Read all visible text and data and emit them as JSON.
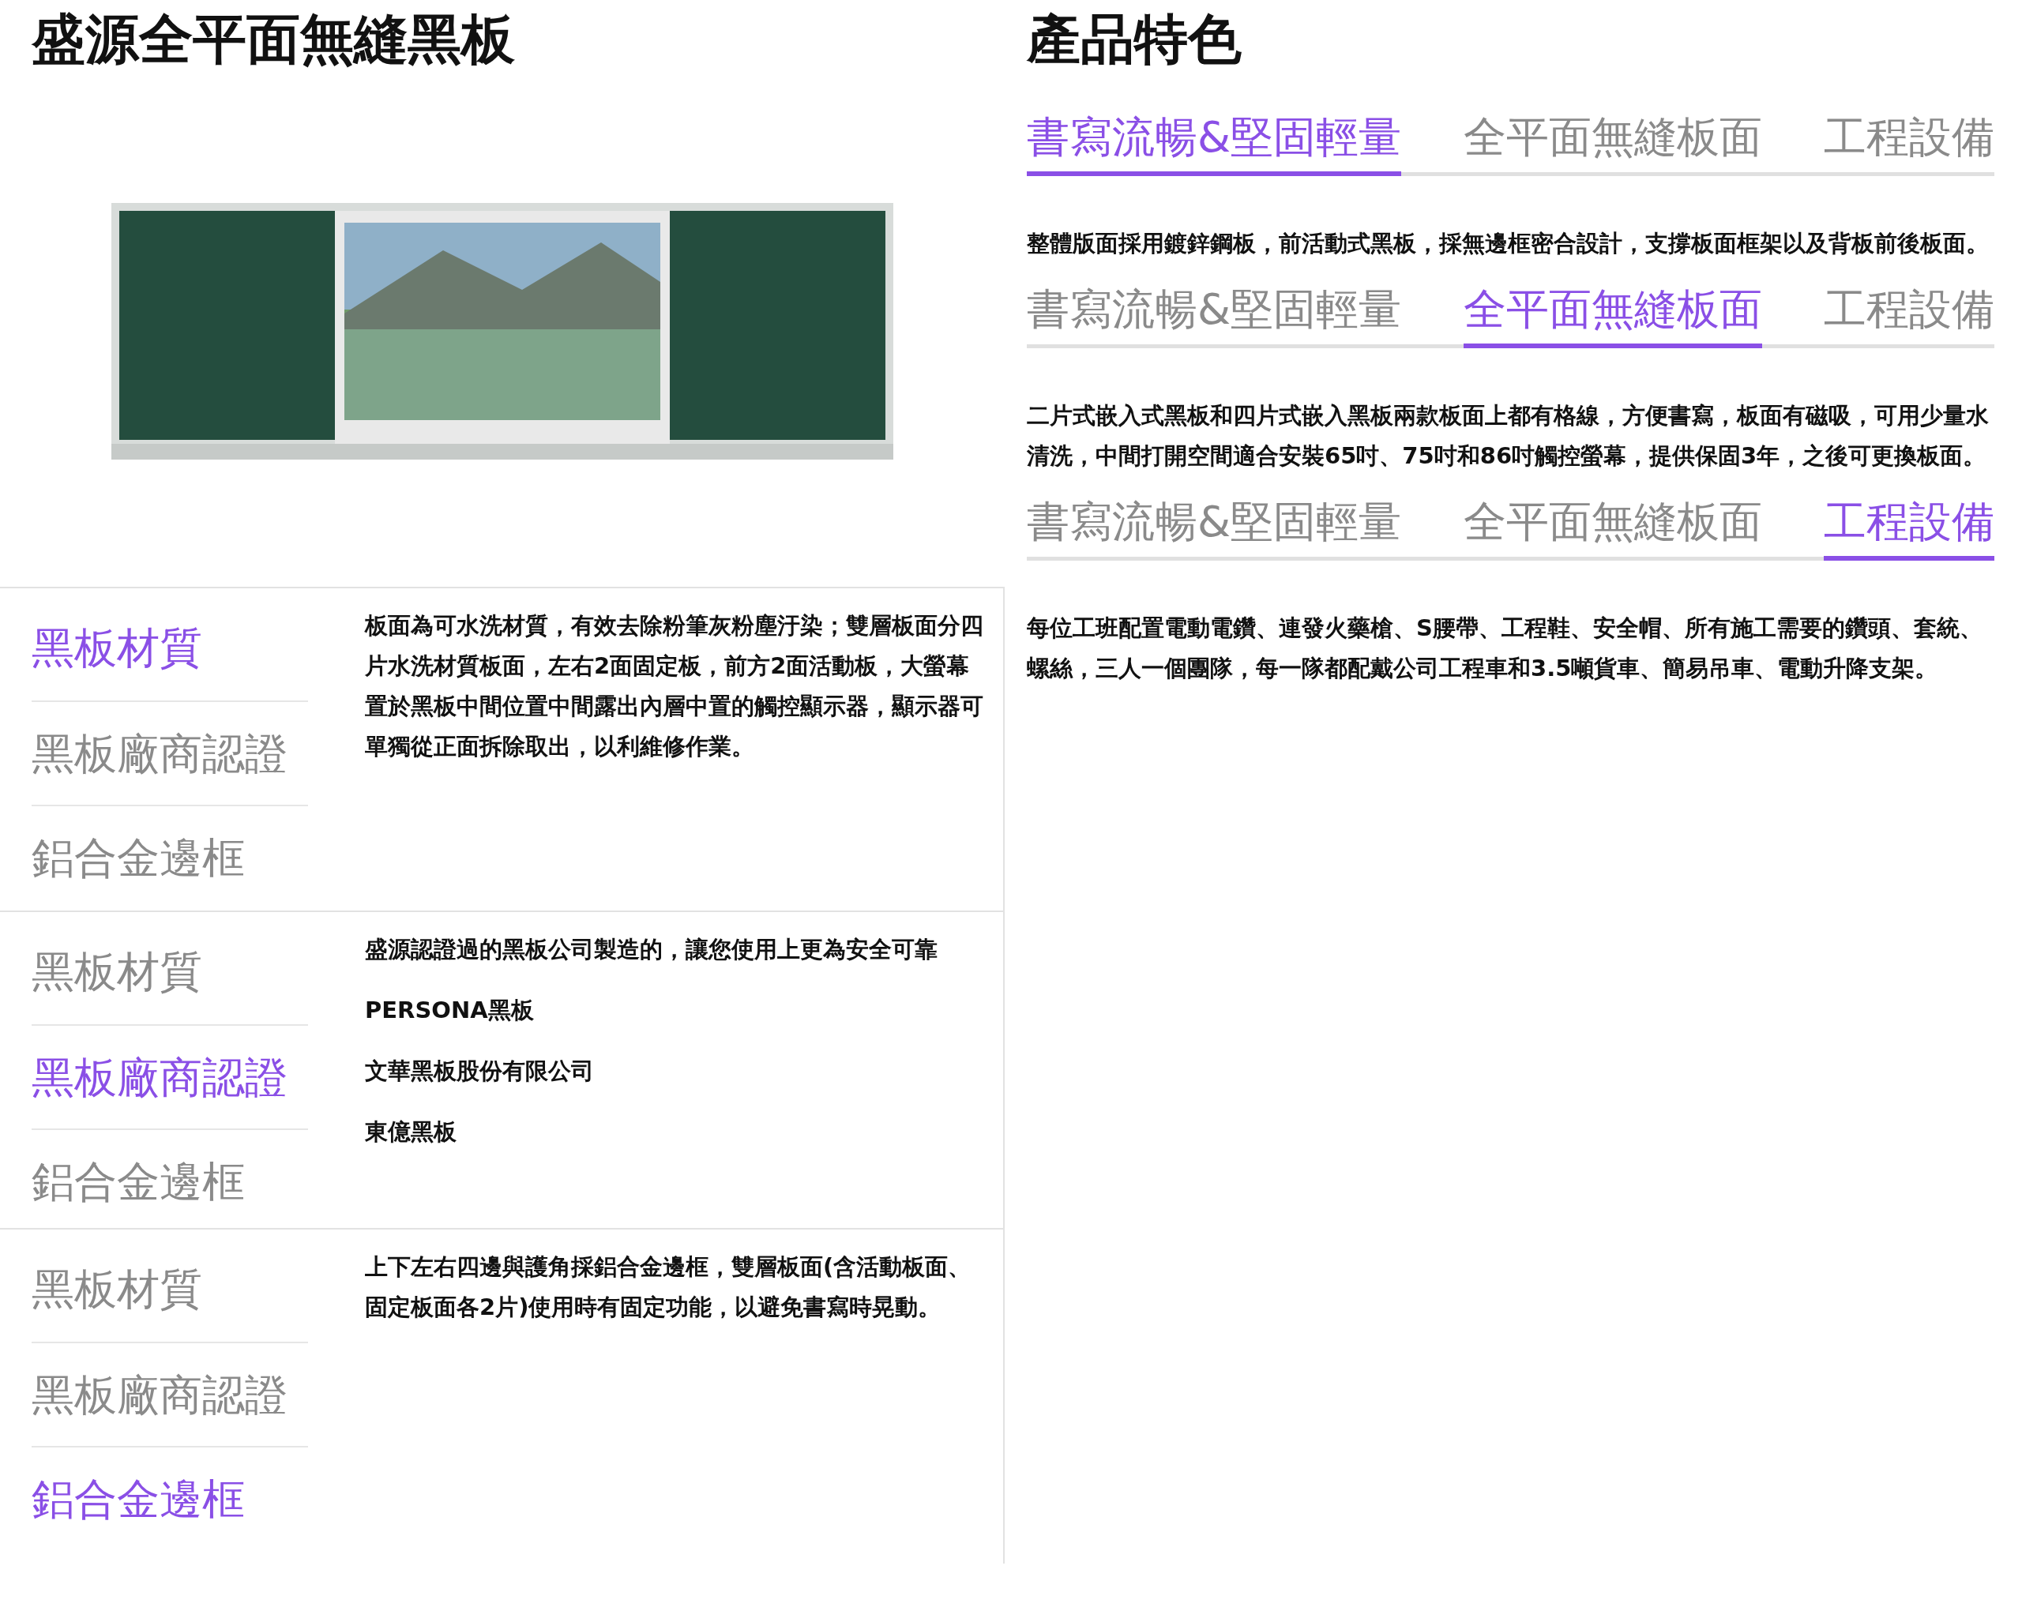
{
  "left": {
    "title": "盛源全平面無縫黑板",
    "panels": [
      {
        "tabs": [
          {
            "label": "黑板材質",
            "selected": true
          },
          {
            "label": "黑板廠商認證",
            "selected": false
          },
          {
            "label": "鋁合金邊框",
            "selected": false
          }
        ],
        "content": [
          "板面為可水洗材質，有效去除粉筆灰粉塵汙染；雙層板面分四片水洗材質板面，左右2面固定板，前方2面活動板，大螢幕置於黑板中間位置中間露出內層中置的觸控顯示器，顯示器可單獨從正面拆除取出，以利維修作業。"
        ]
      },
      {
        "tabs": [
          {
            "label": "黑板材質",
            "selected": false
          },
          {
            "label": "黑板廠商認證",
            "selected": true
          },
          {
            "label": "鋁合金邊框",
            "selected": false
          }
        ],
        "content": [
          "盛源認證過的黑板公司製造的，讓您使用上更為安全可靠",
          "PERSONA黑板",
          "文華黑板股份有限公司",
          "東億黑板"
        ]
      },
      {
        "tabs": [
          {
            "label": "黑板材質",
            "selected": false
          },
          {
            "label": "黑板廠商認證",
            "selected": false
          },
          {
            "label": "鋁合金邊框",
            "selected": true
          }
        ],
        "content": [
          "上下左右四邊與護角採鋁合金邊框，雙層板面(含活動板面、固定板面各2片)使用時有固定功能，以避免書寫時晃動。"
        ]
      }
    ]
  },
  "right": {
    "title": "產品特色",
    "sections": [
      {
        "tabs": [
          {
            "label": "書寫流暢&堅固輕量",
            "selected": true
          },
          {
            "label": "全平面無縫板面",
            "selected": false
          },
          {
            "label": "工程設備",
            "selected": false
          }
        ],
        "text": "整體版面採用鍍鋅鋼板，前活動式黑板，採無邊框密合設計，支撐板面框架以及背板前後板面。"
      },
      {
        "tabs": [
          {
            "label": "書寫流暢&堅固輕量",
            "selected": false
          },
          {
            "label": "全平面無縫板面",
            "selected": true
          },
          {
            "label": "工程設備",
            "selected": false
          }
        ],
        "text": "二片式嵌入式黑板和四片式嵌入黑板兩款板面上都有格線，方便書寫，板面有磁吸，可用少量水清洗，中間打開空間適合安裝65吋、75吋和86吋觸控螢幕，提供保固3年，之後可更換板面。"
      },
      {
        "tabs": [
          {
            "label": "書寫流暢&堅固輕量",
            "selected": false
          },
          {
            "label": "全平面無縫板面",
            "selected": false
          },
          {
            "label": "工程設備",
            "selected": true
          }
        ],
        "text": "每位工班配置電動電鑽、連發火藥槍、S腰帶、工程鞋、安全帽、所有施工需要的鑽頭、套統、螺絲，三人一個團隊，每一隊都配戴公司工程車和3.5噸貨車、簡易吊車、電動升降支架。"
      }
    ]
  }
}
